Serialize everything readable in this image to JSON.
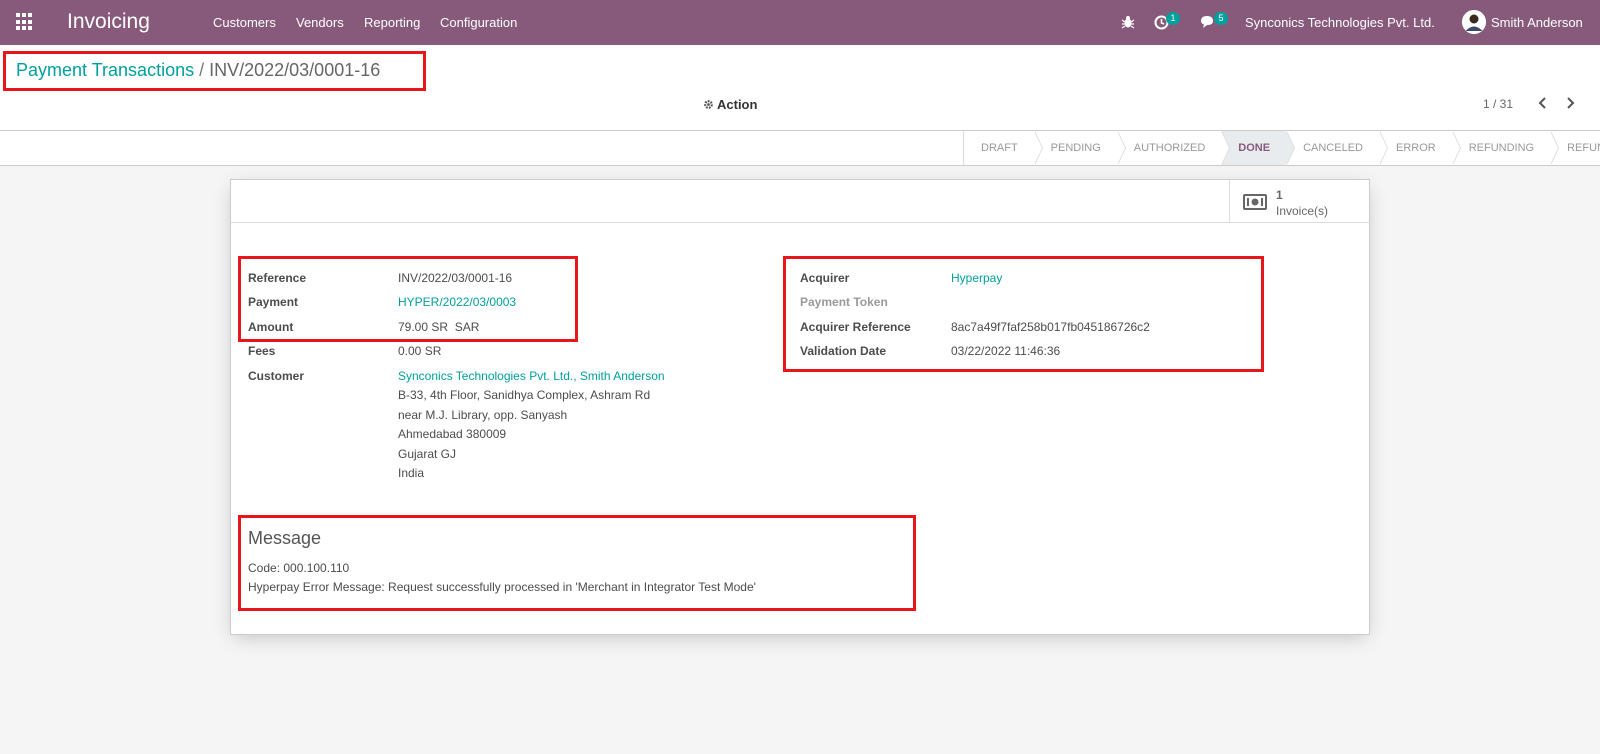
{
  "navbar": {
    "app_title": "Invoicing",
    "menus": [
      "Customers",
      "Vendors",
      "Reporting",
      "Configuration"
    ],
    "activity_count": "1",
    "message_count": "5",
    "company": "Synconics Technologies Pvt. Ltd.",
    "user": "Smith Anderson",
    "color": "#875a7b"
  },
  "breadcrumb": {
    "parent": "Payment Transactions",
    "separator": "/",
    "current": "INV/2022/03/0001-16"
  },
  "control": {
    "action_label": "Action",
    "pager": "1 / 31"
  },
  "status_stages": [
    {
      "label": "DRAFT",
      "active": false
    },
    {
      "label": "PENDING",
      "active": false
    },
    {
      "label": "AUTHORIZED",
      "active": false
    },
    {
      "label": "DONE",
      "active": true
    },
    {
      "label": "CANCELED",
      "active": false
    },
    {
      "label": "ERROR",
      "active": false
    },
    {
      "label": "REFUNDING",
      "active": false
    },
    {
      "label": "REFUNDED",
      "active": false
    }
  ],
  "stat_button": {
    "count": "1",
    "label": "Invoice(s)"
  },
  "left_fields": {
    "reference_label": "Reference",
    "reference": "INV/2022/03/0001-16",
    "payment_label": "Payment",
    "payment": "HYPER/2022/03/0003",
    "amount_label": "Amount",
    "amount": "79.00 SR  SAR",
    "fees_label": "Fees",
    "fees": "0.00 SR",
    "customer_label": "Customer",
    "customer": "Synconics Technologies Pvt. Ltd., Smith Anderson",
    "address": [
      "B-33, 4th Floor, Sanidhya Complex, Ashram Rd",
      "near M.J. Library, opp. Sanyash",
      "Ahmedabad 380009",
      "Gujarat GJ",
      "India"
    ]
  },
  "right_fields": {
    "acquirer_label": "Acquirer",
    "acquirer": "Hyperpay",
    "token_label": "Payment Token",
    "acq_ref_label": "Acquirer Reference",
    "acq_ref": "8ac7a49f7faf258b017fb045186726c2",
    "validation_label": "Validation Date",
    "validation": "03/22/2022 11:46:36"
  },
  "message": {
    "title": "Message",
    "code": "Code: 000.100.110",
    "text": "Hyperpay Error Message: Request successfully processed in 'Merchant in Integrator Test Mode'"
  },
  "colors": {
    "highlight": "#e8151b",
    "link": "#00a09d"
  }
}
